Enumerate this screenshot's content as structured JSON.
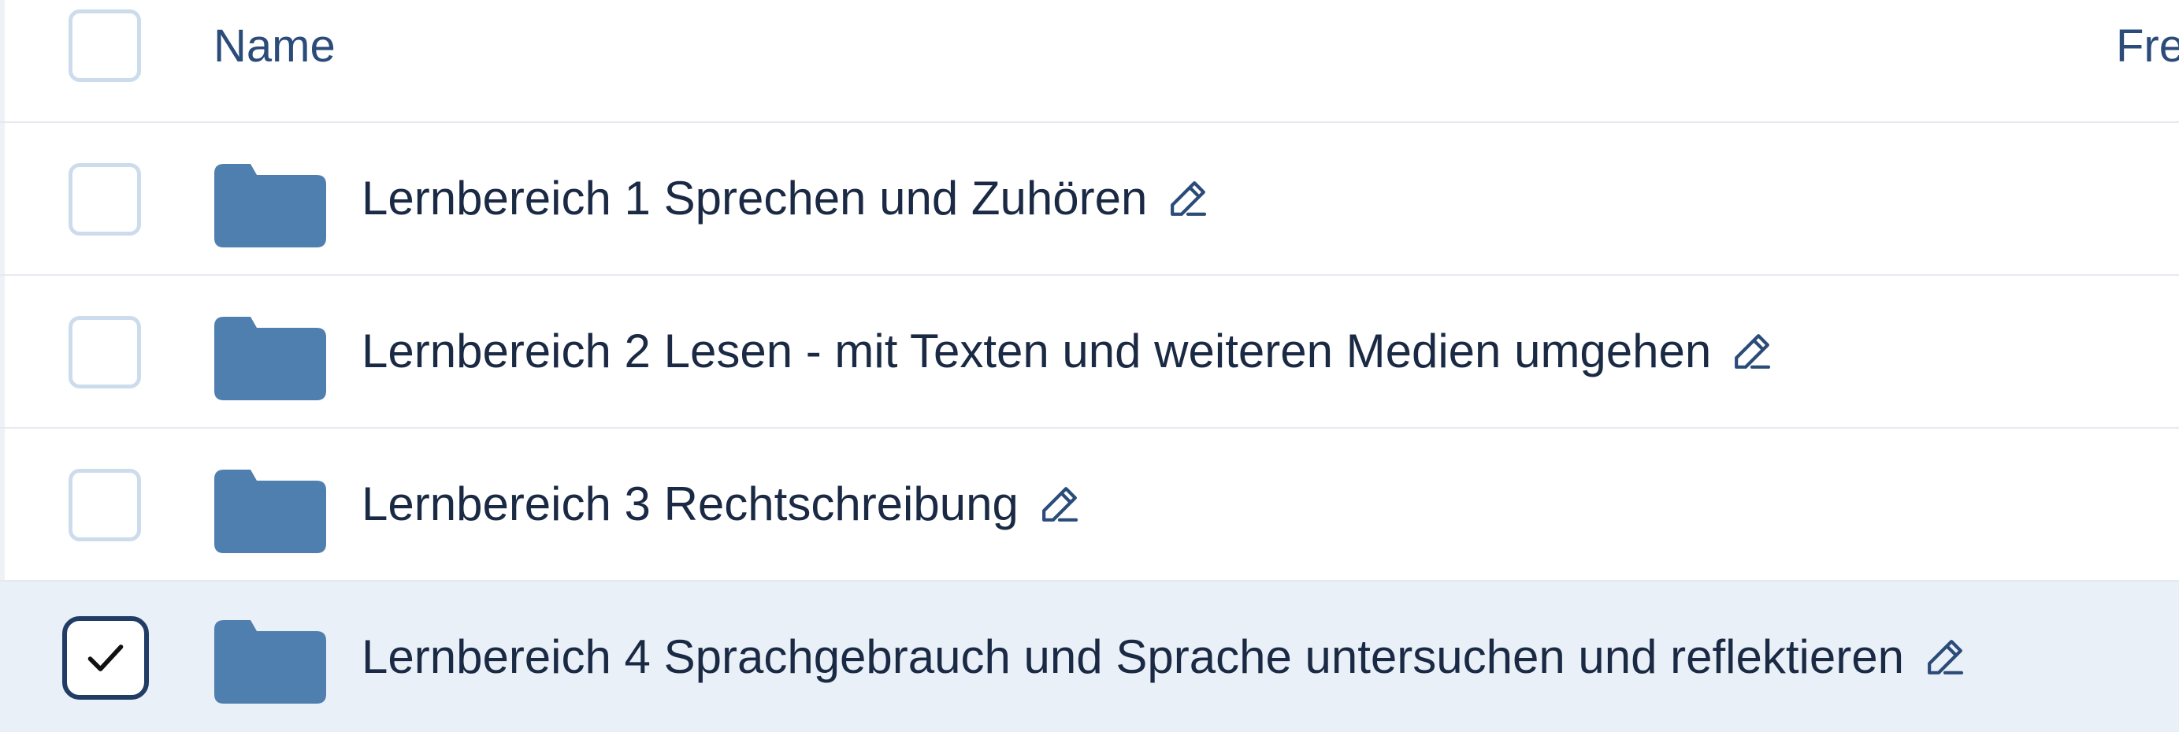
{
  "table": {
    "header": {
      "name_label": "Name",
      "second_column_label": "Fre"
    },
    "rows": [
      {
        "name": "Lernbereich 1 Sprechen und Zuhören",
        "checked": false
      },
      {
        "name": "Lernbereich 2 Lesen - mit Texten und weiteren Medien umgehen",
        "checked": false
      },
      {
        "name": "Lernbereich 3 Rechtschreibung",
        "checked": false
      },
      {
        "name": "Lernbereich 4 Sprachgebrauch und Sprache untersuchen und reflektieren",
        "checked": true
      }
    ]
  },
  "icons": {
    "row_icon": "folder-icon",
    "edit_icon": "pencil-icon",
    "check_icon": "checkmark-icon"
  },
  "colors": {
    "folder": "#4f7faf",
    "header_text": "#2b4b79",
    "row_text": "#1b2a44",
    "selected_row_background": "#e9f0f8",
    "checkbox_border": "#cddced",
    "checked_checkbox_border": "#223d65",
    "divider": "#e6e9ee"
  }
}
